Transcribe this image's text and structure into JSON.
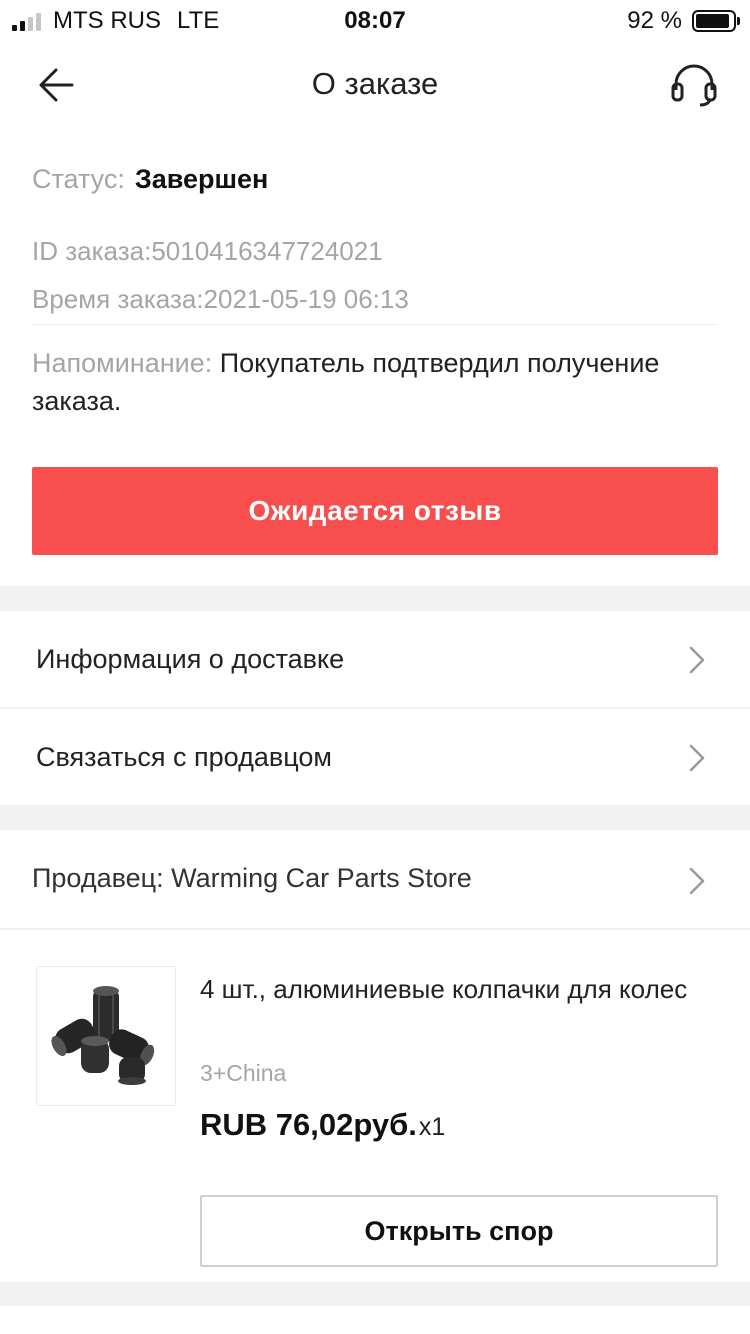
{
  "status_bar": {
    "carrier": "MTS RUS",
    "network": "LTE",
    "time": "08:07",
    "battery": "92 %",
    "battery_level": 0.92
  },
  "nav": {
    "title": "О заказе",
    "back_icon": "arrow-left-icon",
    "support_icon": "headset-icon"
  },
  "order": {
    "status_label": "Статус:",
    "status_value": "Завершен",
    "id_text": "ID заказа:5010416347724021",
    "time_text": "Время заказа:2021-05-19 06:13",
    "reminder_label": "Напоминание:",
    "reminder_text": "Покупатель подтвердил получение заказа.",
    "review_button": "Ожидается отзыв"
  },
  "links": [
    {
      "label": "Информация о доставке"
    },
    {
      "label": "Связаться с продавцом"
    }
  ],
  "seller": {
    "label": "Продавец: Warming Car Parts Store"
  },
  "product": {
    "title": "4 шт., алюминиевые колпачки для колес",
    "variant": "3+China",
    "price": "RUB 76,02руб.",
    "qty": "x1",
    "dispute_button": "Открыть спор"
  },
  "colors": {
    "accent": "#f84e4e",
    "muted_text": "#a5a5a5",
    "background": "#f2f2f2"
  }
}
